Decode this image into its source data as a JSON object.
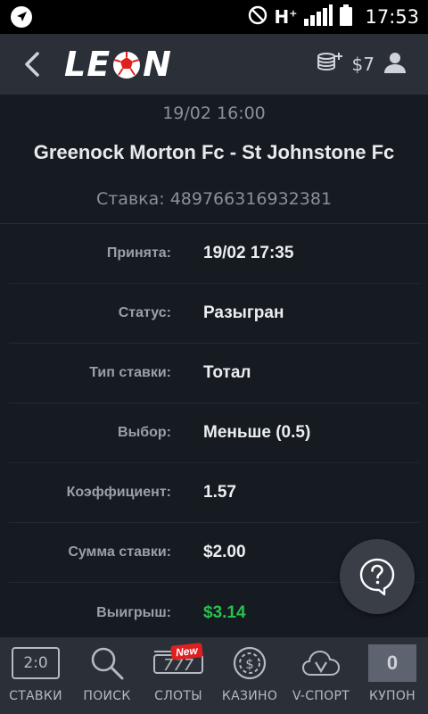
{
  "status_bar": {
    "left_icon": "navigation-arrow-icon",
    "network": "H",
    "network_sup": "+",
    "time": "17:53"
  },
  "app_bar": {
    "logo_left": "LE",
    "logo_right": "N",
    "balance": "$7"
  },
  "event": {
    "date": "19/02 16:00",
    "title": "Greenock Morton Fc - St Johnstone Fc",
    "bet_id": "Ставка: 489766316932381"
  },
  "details": [
    {
      "label": "Принята:",
      "value": "19/02 17:35"
    },
    {
      "label": "Статус:",
      "value": "Разыгран"
    },
    {
      "label": "Тип ставки:",
      "value": "Тотал"
    },
    {
      "label": "Выбор:",
      "value": "Меньше (0.5)"
    },
    {
      "label": "Коэффициент:",
      "value": "1.57"
    },
    {
      "label": "Сумма ставки:",
      "value": "$2.00"
    },
    {
      "label": "Выигрыш:",
      "value": "$3.14"
    }
  ],
  "colors": {
    "win": "#27c24c",
    "accent_red": "#e02020"
  },
  "bottom_nav": {
    "bets": {
      "label": "СТАВКИ",
      "score": "2:0"
    },
    "search": {
      "label": "ПОИСК"
    },
    "slots": {
      "label": "СЛОТЫ",
      "badge": "New",
      "reels": "777"
    },
    "casino": {
      "label": "КАЗИНО"
    },
    "vsport": {
      "label": "V-СПОРТ"
    },
    "coupon": {
      "label": "КУПОН",
      "count": "0"
    }
  }
}
